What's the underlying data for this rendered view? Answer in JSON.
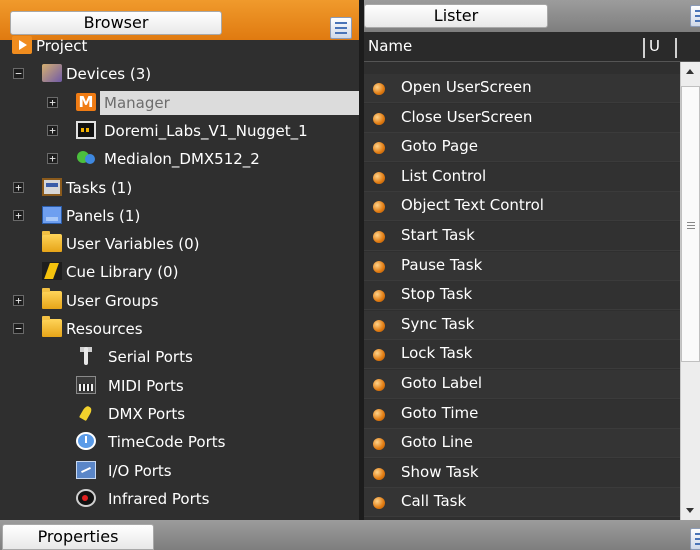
{
  "browser": {
    "tab_label": "Browser",
    "menu_icon": "panel-menu-icon",
    "tree": [
      {
        "id": "project",
        "label": "Project",
        "icon": "project-icon",
        "level": 0,
        "expander": "",
        "selected": false
      },
      {
        "id": "devices",
        "label": "Devices (3)",
        "icon": "devices-icon",
        "level": 1,
        "expander": "−",
        "selected": false
      },
      {
        "id": "manager",
        "label": "Manager",
        "icon": "manager-icon",
        "level": 2,
        "expander": "+",
        "selected": true
      },
      {
        "id": "doremi",
        "label": "Doremi_Labs_V1_Nugget_1",
        "icon": "doremi-device-icon",
        "level": 2,
        "expander": "+",
        "selected": false
      },
      {
        "id": "medialon",
        "label": "Medialon_DMX512_2",
        "icon": "medialon-device-icon",
        "level": 2,
        "expander": "+",
        "selected": false
      },
      {
        "id": "tasks",
        "label": "Tasks (1)",
        "icon": "tasks-icon",
        "level": 1,
        "expander": "+",
        "selected": false
      },
      {
        "id": "panels",
        "label": "Panels (1)",
        "icon": "panels-icon",
        "level": 1,
        "expander": "+",
        "selected": false
      },
      {
        "id": "user_variables",
        "label": "User Variables (0)",
        "icon": "folder-icon",
        "level": 1,
        "expander": "",
        "selected": false
      },
      {
        "id": "cue_library",
        "label": "Cue Library (0)",
        "icon": "cue-library-icon",
        "level": 1,
        "expander": "",
        "selected": false
      },
      {
        "id": "user_groups",
        "label": "User Groups",
        "icon": "folder-icon",
        "level": 1,
        "expander": "+",
        "selected": false
      },
      {
        "id": "resources",
        "label": "Resources",
        "icon": "folder-icon",
        "level": 1,
        "expander": "−",
        "selected": false
      },
      {
        "id": "serial_ports",
        "label": "Serial Ports",
        "icon": "serial-port-icon",
        "level": 2,
        "expander": "",
        "selected": false
      },
      {
        "id": "midi_ports",
        "label": "MIDI Ports",
        "icon": "midi-port-icon",
        "level": 2,
        "expander": "",
        "selected": false
      },
      {
        "id": "dmx_ports",
        "label": "DMX Ports",
        "icon": "dmx-port-icon",
        "level": 2,
        "expander": "",
        "selected": false
      },
      {
        "id": "timecode_ports",
        "label": "TimeCode Ports",
        "icon": "timecode-port-icon",
        "level": 2,
        "expander": "",
        "selected": false
      },
      {
        "id": "io_ports",
        "label": "I/O Ports",
        "icon": "io-port-icon",
        "level": 2,
        "expander": "",
        "selected": false
      },
      {
        "id": "infrared_ports",
        "label": "Infrared Ports",
        "icon": "infrared-port-icon",
        "level": 2,
        "expander": "",
        "selected": false
      }
    ]
  },
  "lister": {
    "tab_label": "Lister",
    "columns": {
      "name": "Name",
      "u": "U"
    },
    "items": [
      "Open UserScreen",
      "Close UserScreen",
      "Goto Page",
      "List Control",
      "Object Text Control",
      "Start Task",
      "Pause Task",
      "Stop Task",
      "Sync Task",
      "Lock Task",
      "Goto Label",
      "Goto Time",
      "Goto Line",
      "Show Task",
      "Call Task"
    ],
    "item_icon": "command-bullet-icon"
  },
  "properties": {
    "tab_label": "Properties"
  },
  "colors": {
    "accent": "#f08c1e",
    "panel_bg": "#2f2f2f",
    "selection_bg": "#dcdcdc"
  }
}
